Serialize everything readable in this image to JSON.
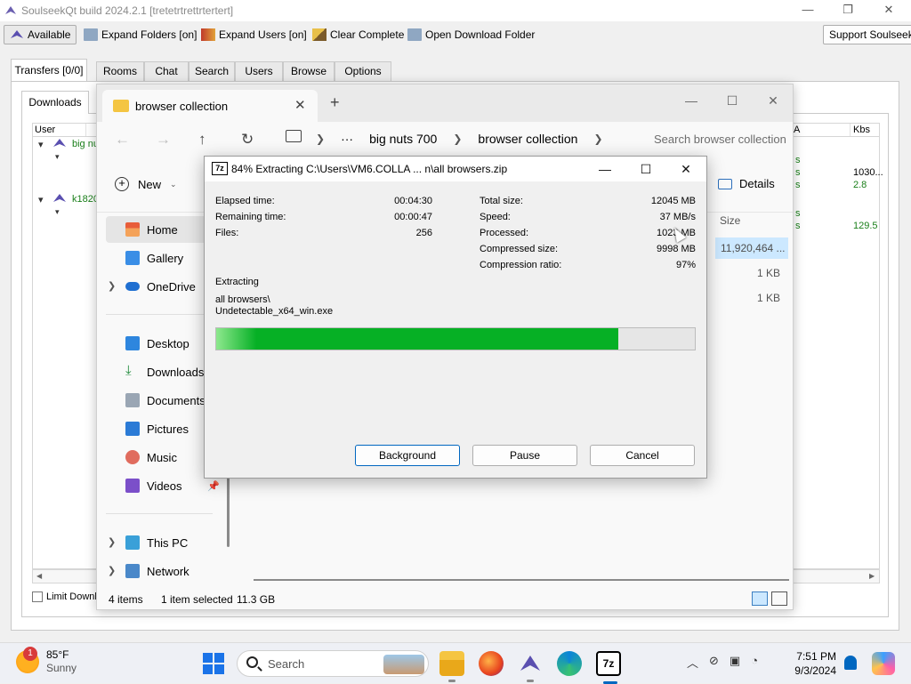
{
  "soulseek": {
    "title": "SoulseekQt build 2024.2.1 [tretetrtrettrtertert]",
    "toolbar": {
      "available": "Available",
      "expand_folders": "Expand Folders [on]",
      "expand_users": "Expand Users [on]",
      "clear_complete": "Clear Complete",
      "open_download_folder": "Open Download Folder",
      "support": "Support Soulseek!"
    },
    "tabs": [
      "Transfers [0/0]",
      "Rooms",
      "Chat",
      "Search",
      "Users",
      "Browse",
      "Options"
    ],
    "subtab": "Downloads",
    "columns": {
      "user": "User",
      "a": "A",
      "kbs": "Kbs"
    },
    "rows": [
      {
        "user": "big nuts",
        "status1": "s",
        "status2": "s",
        "kbs": "1030..."
      },
      {
        "status": "s",
        "kbs": "2.8"
      },
      {
        "user": "k1820",
        "status1": "s",
        "status2": "s",
        "kbs": "129.5"
      }
    ],
    "limit_label": "Limit Downl"
  },
  "explorer": {
    "tab_title": "browser collection",
    "breadcrumbs": [
      "big nuts 700",
      "browser collection"
    ],
    "search_placeholder": "Search browser collection",
    "new_label": "New",
    "details_label": "Details",
    "size_header": "Size",
    "sizes": [
      "11,920,464 ...",
      "1 KB",
      "1 KB"
    ],
    "nav": {
      "home": "Home",
      "gallery": "Gallery",
      "onedrive": "OneDrive",
      "desktop": "Desktop",
      "downloads": "Downloads",
      "documents": "Documents",
      "pictures": "Pictures",
      "music": "Music",
      "videos": "Videos",
      "thispc": "This PC",
      "network": "Network"
    },
    "status": {
      "items": "4 items",
      "selected": "1 item selected",
      "size": "11.3 GB"
    }
  },
  "zip": {
    "title": "84% Extracting C:\\Users\\VM6.COLLA ... n\\all browsers.zip",
    "left": [
      {
        "label": "Elapsed time:",
        "value": "00:04:30"
      },
      {
        "label": "Remaining time:",
        "value": "00:00:47"
      },
      {
        "label": "Files:",
        "value": "256"
      }
    ],
    "right": [
      {
        "label": "Total size:",
        "value": "12045 MB"
      },
      {
        "label": "Speed:",
        "value": "37 MB/s"
      },
      {
        "label": "Processed:",
        "value": "1023 MB"
      },
      {
        "label": "Compressed size:",
        "value": "9998 MB"
      },
      {
        "label": "Compression ratio:",
        "value": "97%"
      }
    ],
    "action": "Extracting",
    "path_line1": "all browsers\\",
    "path_line2": "Undetectable_x64_win.exe",
    "progress_percent": 84,
    "buttons": {
      "background": "Background",
      "pause": "Pause",
      "cancel": "Cancel"
    }
  },
  "taskbar": {
    "weather_badge": "1",
    "temp": "85°F",
    "condition": "Sunny",
    "search_label": "Search",
    "time": "7:51 PM",
    "date": "9/3/2024"
  },
  "colors": {
    "progress": "#06b025",
    "accent": "#0067c0",
    "soulseek_green": "#1a7f1a"
  }
}
